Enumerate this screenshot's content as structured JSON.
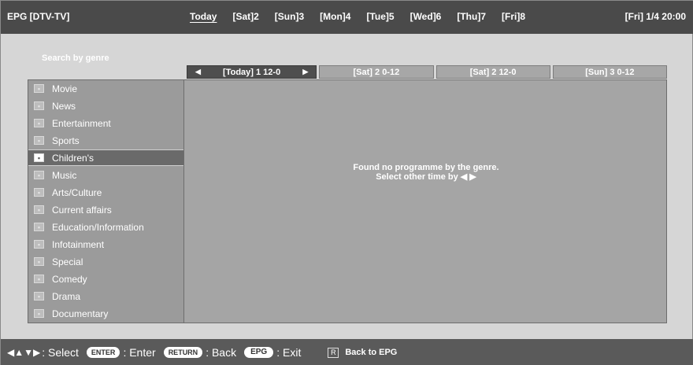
{
  "header": {
    "title": "EPG [DTV-TV]",
    "days": [
      "Today",
      "[Sat]2",
      "[Sun]3",
      "[Mon]4",
      "[Tue]5",
      "[Wed]6",
      "[Thu]7",
      "[Fri]8"
    ],
    "clock": "[Fri]  1/4  20:00"
  },
  "search_label": "Search by genre",
  "slots": [
    {
      "label": "[Today] 1 12-0",
      "active": true
    },
    {
      "label": "[Sat] 2 0-12",
      "active": false
    },
    {
      "label": "[Sat] 2 12-0",
      "active": false
    },
    {
      "label": "[Sun] 3 0-12",
      "active": false
    }
  ],
  "genres": [
    {
      "label": "Movie",
      "icon": "movie-icon"
    },
    {
      "label": "News",
      "icon": "news-icon"
    },
    {
      "label": "Entertainment",
      "icon": "entertainment-icon"
    },
    {
      "label": "Sports",
      "icon": "sports-icon"
    },
    {
      "label": "Children's",
      "icon": "childrens-icon",
      "selected": true
    },
    {
      "label": "Music",
      "icon": "music-icon"
    },
    {
      "label": "Arts/Culture",
      "icon": "arts-culture-icon"
    },
    {
      "label": "Current affairs",
      "icon": "current-affairs-icon"
    },
    {
      "label": "Education/Information",
      "icon": "education-icon"
    },
    {
      "label": "Infotainment",
      "icon": "infotainment-icon"
    },
    {
      "label": "Special",
      "icon": "special-icon"
    },
    {
      "label": "Comedy",
      "icon": "comedy-icon"
    },
    {
      "label": "Drama",
      "icon": "drama-icon"
    },
    {
      "label": "Documentary",
      "icon": "documentary-icon"
    }
  ],
  "message": {
    "line1": "Found no programme by the genre.",
    "line2": "Select other time by ◀ ▶"
  },
  "footer": {
    "select": ": Select",
    "enter_key": "ENTER",
    "enter": ": Enter",
    "return_key": "RETURN",
    "back": ": Back",
    "epg_key": "EPG",
    "exit": ": Exit",
    "r_key": "R",
    "back_to_epg": "Back to EPG"
  }
}
